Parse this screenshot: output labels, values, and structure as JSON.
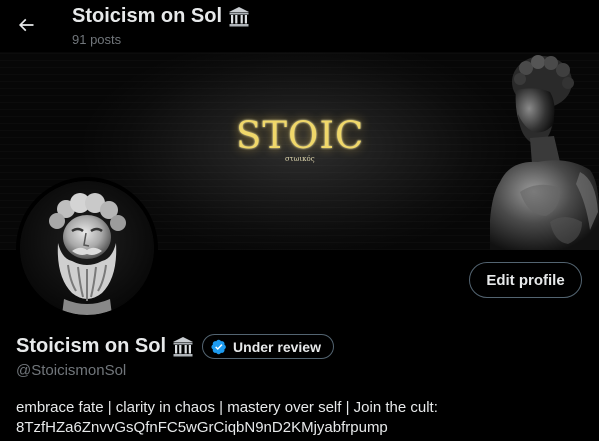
{
  "header": {
    "title": "Stoicism on Sol",
    "posts_count": "91 posts"
  },
  "banner": {
    "logo_text": "STOIC",
    "logo_subtext": "στωικός"
  },
  "profile": {
    "display_name": "Stoicism on Sol",
    "badge_label": "Under review",
    "handle": "@StoicismonSol",
    "bio_line1": "embrace fate | clarity in chaos | mastery over self | Join the cult:",
    "bio_line2": "8TzfHZa6ZnvvGsQfnFC5wGrCiqbN9nD2KMjyabfrpump",
    "edit_label": "Edit profile"
  },
  "colors": {
    "background": "#000000",
    "text_primary": "#e7e9ea",
    "text_secondary": "#71767b",
    "border": "#536471",
    "verified_blue": "#1d9bf0",
    "banner_gold": "#f0d86a"
  },
  "icons": {
    "back": "arrow-left-icon",
    "temple": "classical-building-icon",
    "verified": "verified-badge-icon"
  }
}
